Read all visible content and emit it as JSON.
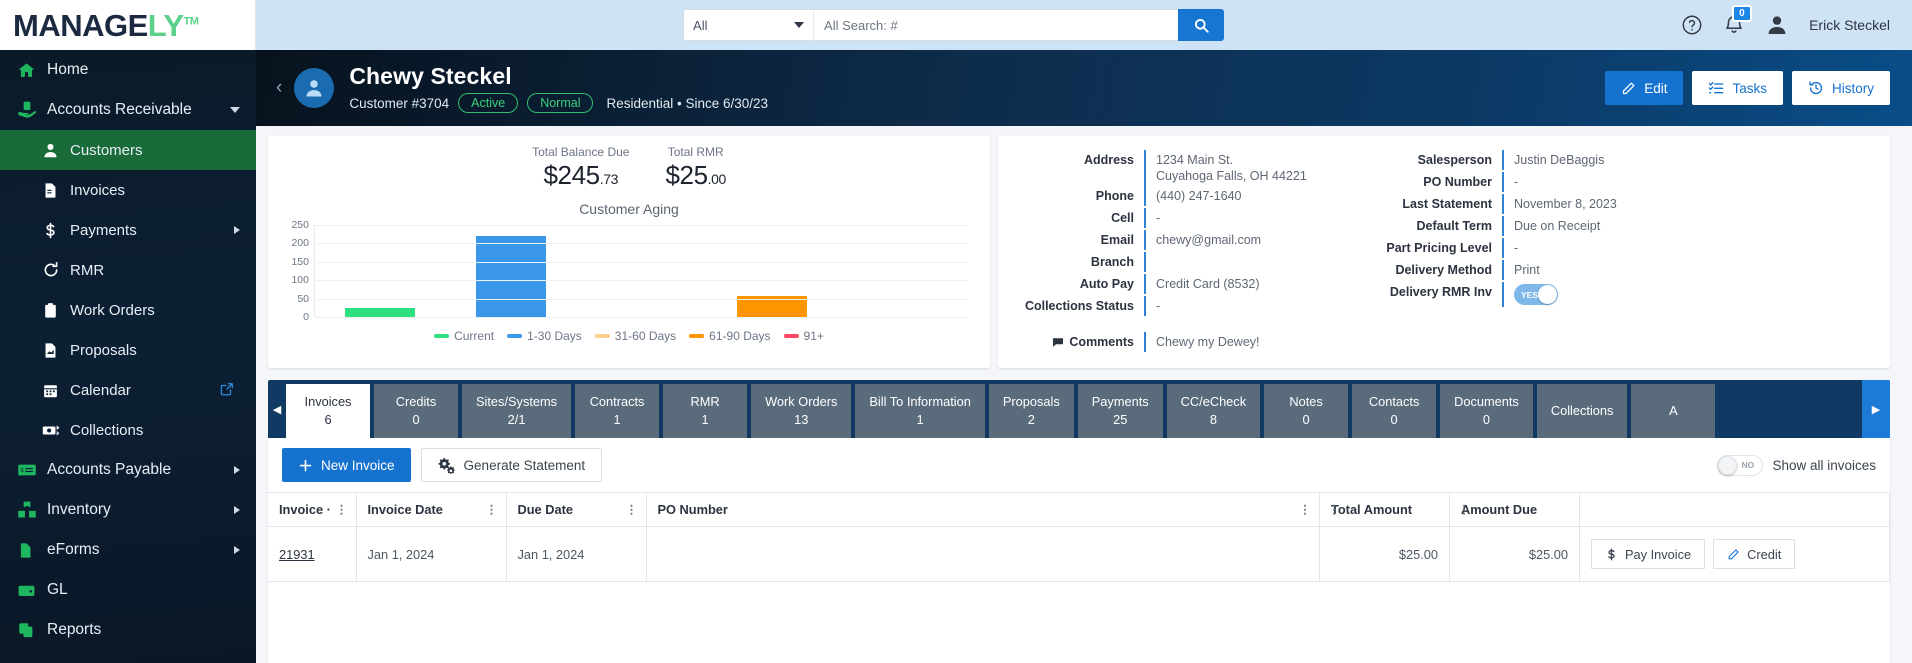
{
  "topbar": {
    "logo_main": "MANAGE",
    "logo_accent": "LY",
    "logo_tm": "TM",
    "search_scope": "All",
    "search_placeholder": "All Search: #",
    "search_value": "",
    "notification_count": "0",
    "user_name": "Erick Steckel"
  },
  "sidebar": {
    "items": [
      {
        "label": "Home",
        "icon": "home-icon"
      },
      {
        "label": "Accounts Receivable",
        "icon": "hand-money-icon"
      },
      {
        "label": "Customers",
        "icon": "person-icon"
      },
      {
        "label": "Invoices",
        "icon": "invoice-icon"
      },
      {
        "label": "Payments",
        "icon": "dollar-icon"
      },
      {
        "label": "RMR",
        "icon": "refresh-icon"
      },
      {
        "label": "Work Orders",
        "icon": "clipboard-icon"
      },
      {
        "label": "Proposals",
        "icon": "document-chart-icon"
      },
      {
        "label": "Calendar",
        "icon": "calendar-icon"
      },
      {
        "label": "Collections",
        "icon": "cash-exchange-icon"
      },
      {
        "label": "Accounts Payable",
        "icon": "check-icon"
      },
      {
        "label": "Inventory",
        "icon": "boxes-icon"
      },
      {
        "label": "eForms",
        "icon": "page-icon"
      },
      {
        "label": "GL",
        "icon": "wallet-icon"
      },
      {
        "label": "Reports",
        "icon": "copy-icon"
      }
    ]
  },
  "customer": {
    "name": "Chewy Steckel",
    "number": "Customer #3704",
    "status_badge": "Active",
    "priority_badge": "Normal",
    "type_line": "Residential • Since 6/30/23",
    "actions": {
      "edit": "Edit",
      "tasks": "Tasks",
      "history": "History"
    }
  },
  "summary": {
    "total_balance_label": "Total Balance Due",
    "total_balance_dollars": "$245",
    "total_balance_cents": ".73",
    "total_rmr_label": "Total RMR",
    "total_rmr_dollars": "$25",
    "total_rmr_cents": ".00"
  },
  "chart_data": {
    "type": "bar",
    "title": "Customer Aging",
    "categories": [
      "Current",
      "1-30 Days",
      "31-60 Days",
      "61-90 Days",
      "91+"
    ],
    "values": [
      25,
      220,
      0,
      58,
      0
    ],
    "colors": [
      "#2ee07f",
      "#3a96e8",
      "#ffcf8c",
      "#ff9500",
      "#f8485e"
    ],
    "legend": [
      "Current",
      "1-30 Days",
      "31-60 Days",
      "61-90 Days",
      "91+"
    ],
    "legend_position": "bottom",
    "ylim": [
      0,
      250
    ],
    "yticks": [
      0,
      50,
      100,
      150,
      200,
      250
    ],
    "xlabel": "",
    "ylabel": "",
    "grid": true
  },
  "info_left": [
    {
      "label": "Address",
      "value": "1234 Main St.\nCuyahoga Falls, OH 44221"
    },
    {
      "label": "Phone",
      "value": "(440) 247-1640"
    },
    {
      "label": "Cell",
      "value": "-"
    },
    {
      "label": "Email",
      "value": "chewy@gmail.com"
    },
    {
      "label": "Branch",
      "value": ""
    },
    {
      "label": "Auto Pay",
      "value": "Credit Card (8532)"
    },
    {
      "label": "Collections Status",
      "value": "-"
    }
  ],
  "info_comments": {
    "label": "Comments",
    "value": "Chewy my Dewey!"
  },
  "info_right": [
    {
      "label": "Salesperson",
      "value": "Justin DeBaggis"
    },
    {
      "label": "PO Number",
      "value": "-"
    },
    {
      "label": "Last Statement",
      "value": "November 8, 2023"
    },
    {
      "label": "Default Term",
      "value": "Due on Receipt"
    },
    {
      "label": "Part Pricing Level",
      "value": "-"
    },
    {
      "label": "Delivery Method",
      "value": "Print"
    }
  ],
  "delivery_rmr": {
    "label": "Delivery RMR Inv",
    "toggle_text": "YES",
    "toggle_on": true
  },
  "tabs": [
    {
      "label": "Invoices",
      "count": "6",
      "active": true
    },
    {
      "label": "Credits",
      "count": "0",
      "active": false
    },
    {
      "label": "Sites/Systems",
      "count": "2/1",
      "active": false
    },
    {
      "label": "Contracts",
      "count": "1",
      "active": false
    },
    {
      "label": "RMR",
      "count": "1",
      "active": false
    },
    {
      "label": "Work Orders",
      "count": "13",
      "active": false
    },
    {
      "label": "Bill To Information",
      "count": "1",
      "active": false
    },
    {
      "label": "Proposals",
      "count": "2",
      "active": false
    },
    {
      "label": "Payments",
      "count": "25",
      "active": false
    },
    {
      "label": "CC/eCheck",
      "count": "8",
      "active": false
    },
    {
      "label": "Notes",
      "count": "0",
      "active": false
    },
    {
      "label": "Contacts",
      "count": "0",
      "active": false
    },
    {
      "label": "Documents",
      "count": "0",
      "active": false
    },
    {
      "label": "Collections",
      "count": "",
      "active": false
    },
    {
      "label": "A",
      "count": "",
      "active": false
    }
  ],
  "panel_toolbar": {
    "new_invoice": "New Invoice",
    "generate_statement": "Generate Statement",
    "show_all_label": "Show all invoices",
    "show_all_toggle": "NO"
  },
  "table": {
    "columns": [
      "Invoice ·",
      "Invoice Date",
      "Due Date",
      "PO Number",
      "Total Amount",
      "Amount Due",
      ""
    ],
    "rows": [
      {
        "invoice": "21931",
        "invoice_date": "Jan 1, 2024",
        "due_date": "Jan 1, 2024",
        "po_number": "",
        "total_amount": "$25.00",
        "amount_due": "$25.00",
        "pay_label": "Pay Invoice",
        "credit_label": "Credit"
      }
    ]
  }
}
